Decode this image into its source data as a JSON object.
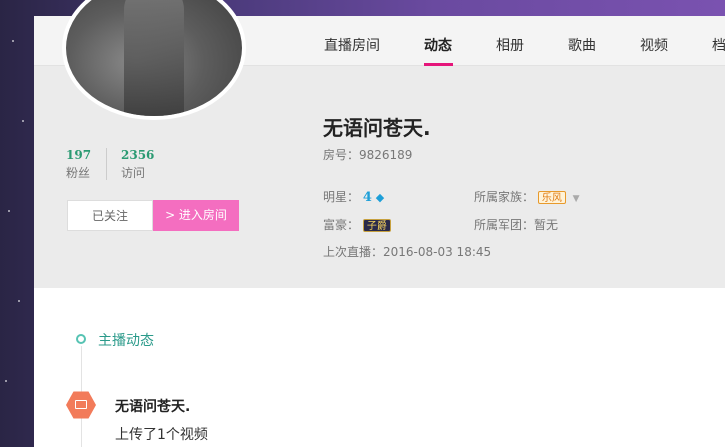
{
  "tabs": [
    {
      "label": "直播房间",
      "active": false
    },
    {
      "label": "动态",
      "active": true
    },
    {
      "label": "相册",
      "active": false
    },
    {
      "label": "歌曲",
      "active": false
    },
    {
      "label": "视频",
      "active": false
    },
    {
      "label": "档",
      "active": false
    }
  ],
  "profile": {
    "fans_count": "197",
    "fans_label": "粉丝",
    "visits_count": "2356",
    "visits_label": "访问",
    "follow_label": "已关注",
    "enter_room_label": "> 进入房间",
    "name": "无语问苍天.",
    "room_text": "房号：9826189",
    "star_label": "明星：",
    "star_level": "4",
    "rich_label": "富豪：",
    "rich_badge": "子爵",
    "family_label": "所属家族：",
    "family_badge": "乐风",
    "group_text": "所属军团：暂无",
    "last_live": "上次直播：2016-08-03 18:45"
  },
  "timeline": {
    "title": "主播动态",
    "post_author": "无语问苍天.",
    "post_text": "上传了1个视频"
  },
  "icons": {
    "diamond": "diamond-icon",
    "video": "video-icon",
    "caret": "caret-down-icon"
  },
  "colors": {
    "accent_pink": "#e5157a",
    "enter_button": "#f46ec0",
    "stat_green": "#2a9a72",
    "timeline_teal": "#2a9a8a",
    "hex_orange": "#f27b5a"
  }
}
